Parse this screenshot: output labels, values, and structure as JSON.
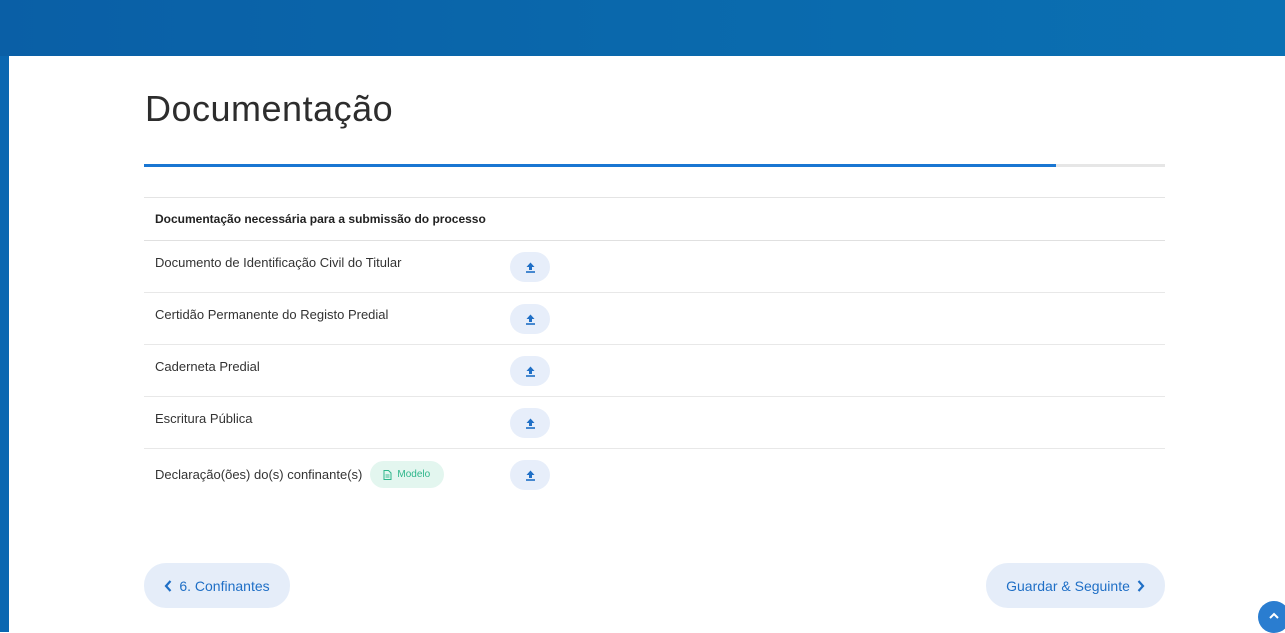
{
  "colors": {
    "header_blue": "#0a67b1",
    "accent_blue": "#1976d2",
    "button_bg": "#e5edf9",
    "badge_green": "#2fb68b"
  },
  "page": {
    "title": "Documentação",
    "progress_fraction": 0.893
  },
  "documents": {
    "header": "Documentação necessária para a submissão do processo",
    "rows": [
      {
        "label": "Documento de Identificação Civil do Titular",
        "action_icon": "upload-icon"
      },
      {
        "label": "Certidão Permanente do Registo Predial",
        "action_icon": "upload-icon"
      },
      {
        "label": "Caderneta Predial",
        "action_icon": "upload-icon"
      },
      {
        "label": "Escritura Pública",
        "action_icon": "upload-icon"
      },
      {
        "label": "Declaração(ões) do(s) confinante(s)",
        "badge": "Modelo",
        "badge_icon": "document-icon",
        "action_icon": "upload-icon"
      }
    ]
  },
  "navigation": {
    "prev_label": "6. Confinantes",
    "next_label": "Guardar & Seguinte"
  }
}
